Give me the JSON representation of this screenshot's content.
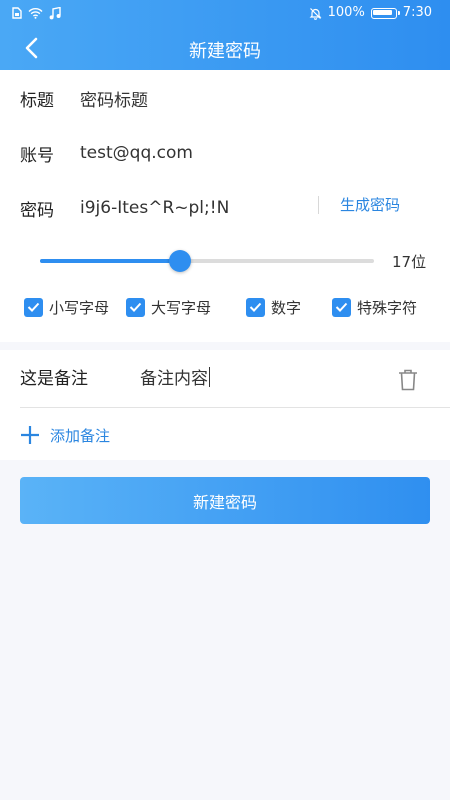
{
  "status_bar": {
    "battery": "100%",
    "time": "7:30"
  },
  "header": {
    "title": "新建密码"
  },
  "form": {
    "title_label": "标题",
    "title_value": "密码标题",
    "account_label": "账号",
    "account_value": "test@qq.com",
    "password_label": "密码",
    "password_value": "i9j6-Ites^R~pl;!N",
    "generate_label": "生成密码"
  },
  "length": {
    "value_fraction": 0.42,
    "label": "17位"
  },
  "options": [
    {
      "label": "小写字母",
      "checked": true
    },
    {
      "label": "大写字母",
      "checked": true
    },
    {
      "label": "数字",
      "checked": true
    },
    {
      "label": "特殊字符",
      "checked": true
    }
  ],
  "note": {
    "title": "这是备注",
    "content": "备注内容",
    "add_label": "添加备注"
  },
  "submit": {
    "label": "新建密码"
  },
  "colors": {
    "accent": "#2e8ef0",
    "link": "#2b86e0",
    "background": "#f6f7fb"
  }
}
